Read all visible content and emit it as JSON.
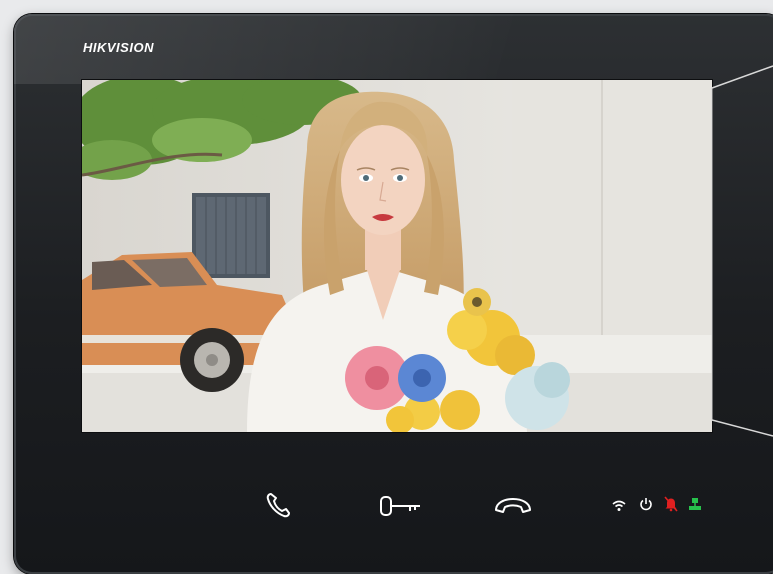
{
  "device": {
    "brand": "HIKVISION"
  },
  "screen": {
    "content": "live-video-feed"
  },
  "controls": [
    {
      "name": "call-button",
      "icon": "phone-icon"
    },
    {
      "name": "unlock-button",
      "icon": "key-icon"
    },
    {
      "name": "hang-up-button",
      "icon": "hang-up-icon"
    }
  ],
  "status_indicators": [
    {
      "name": "wifi-status",
      "icon": "wifi-icon",
      "color": "#ffffff"
    },
    {
      "name": "power-status",
      "icon": "power-icon",
      "color": "#ffffff"
    },
    {
      "name": "mute-status",
      "icon": "bell-muted-icon",
      "color": "#e02020"
    },
    {
      "name": "network-status",
      "icon": "network-icon",
      "color": "#27c24c"
    }
  ],
  "colors": {
    "panel": "#1c1e21",
    "alert": "#e02020",
    "ok": "#27c24c"
  }
}
